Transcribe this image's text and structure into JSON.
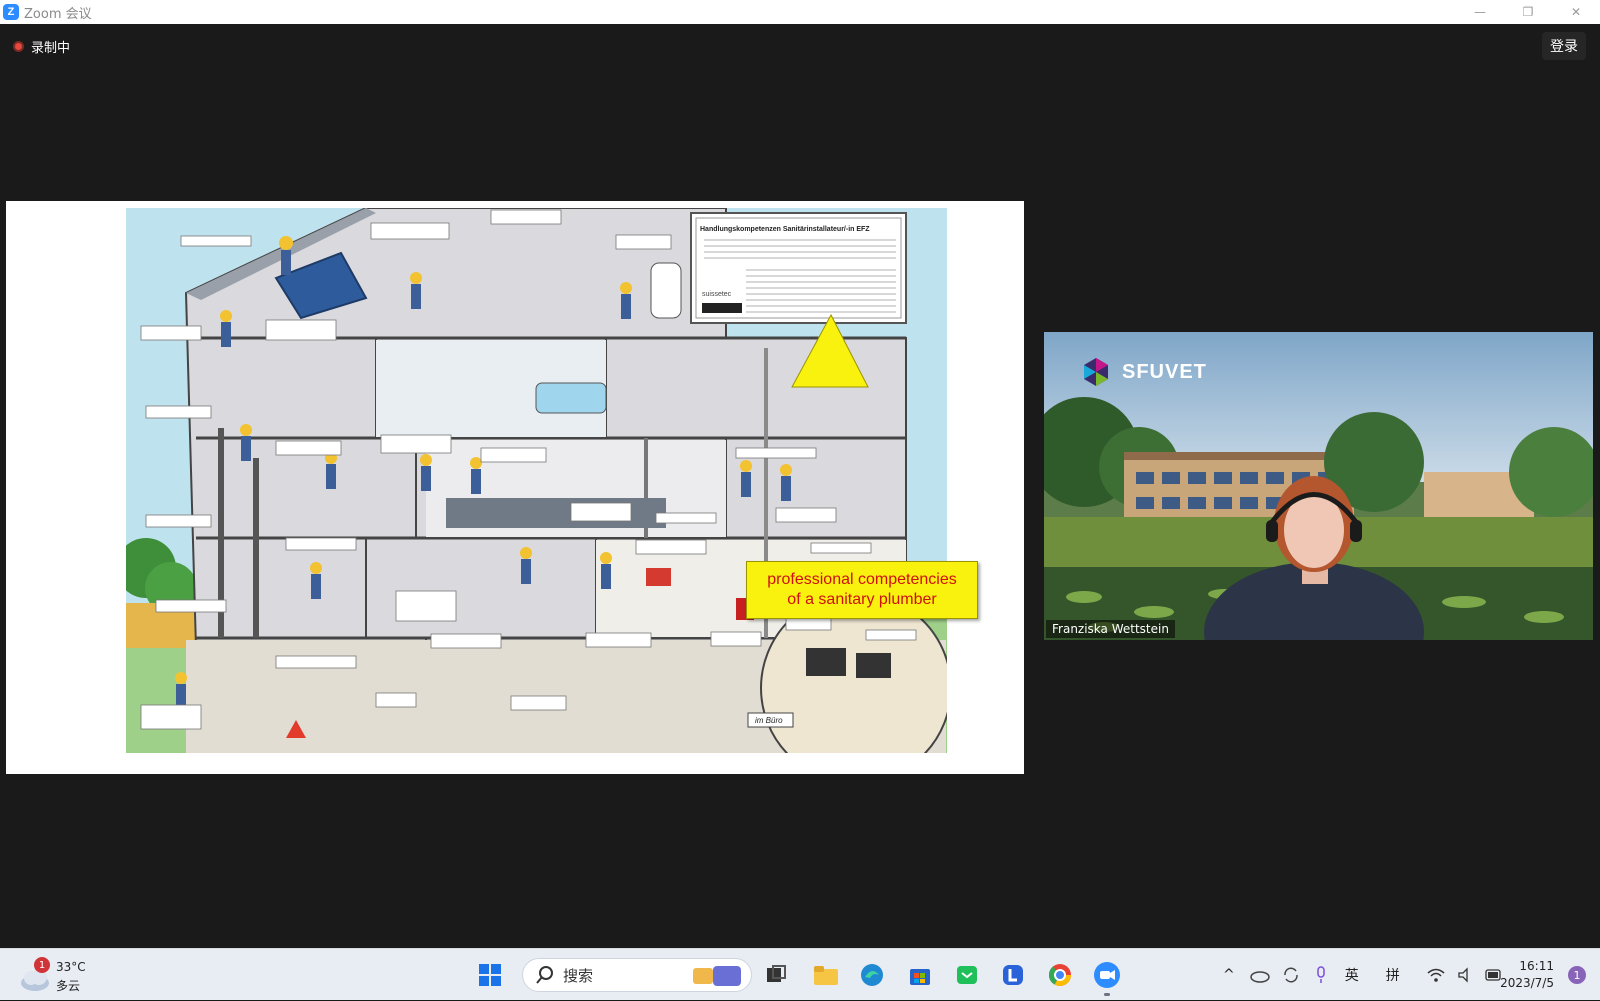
{
  "window": {
    "logo_letter": "Z",
    "title": "Zoom 会议",
    "controls": [
      "—",
      "❐",
      "✕"
    ]
  },
  "meeting": {
    "recording_label": "录制中",
    "login_button": "登录"
  },
  "shared_screen": {
    "callout_line1": "professional competencies",
    "callout_line2": "of a sanitary plumber",
    "poster_box_title": "Handlungskompetenzen Sanitärinstallateur/-in EFZ",
    "poster_corner_label": "im Büro",
    "poster_brand": "suissetec"
  },
  "video": {
    "brand": "SFUVET",
    "participant_name": "Franziska Wettstein"
  },
  "taskbar": {
    "weather_temp": "33°C",
    "weather_desc": "多云",
    "weather_badge": "1",
    "search_placeholder": "搜索",
    "tray_input_lang": "英",
    "tray_ime": "拼",
    "time": "16:11",
    "date": "2023/7/5",
    "notification_count": "1"
  },
  "colors": {
    "zoom_blue": "#2d8cff",
    "record_red": "#e5483c",
    "callout_yellow": "#f9f20f",
    "callout_text": "#d01010"
  }
}
